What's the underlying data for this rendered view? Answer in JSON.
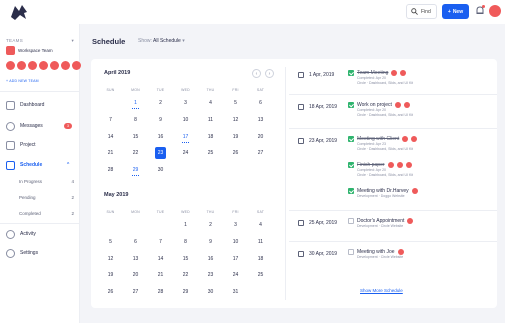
{
  "topbar": {
    "find_label": "Find",
    "new_label": "New",
    "brand_color": "#1a5ff0",
    "alert_color": "#ef5a5a"
  },
  "sidebar": {
    "teams_label": "TEAMS",
    "team_name": "Workspace Team",
    "add_team_label": "+ ADD NEW TEAM",
    "nav": [
      {
        "label": "Dashboard",
        "icon": "grid-icon"
      },
      {
        "label": "Messages",
        "icon": "chat-icon",
        "badge": "3"
      },
      {
        "label": "Project",
        "icon": "check-square-icon"
      },
      {
        "label": "Schedule",
        "icon": "calendar-icon",
        "active": true
      }
    ],
    "sub": [
      {
        "label": "In Progress",
        "count": "4"
      },
      {
        "label": "Pending",
        "count": "2"
      },
      {
        "label": "Completed",
        "count": "2"
      }
    ],
    "nav_bottom": [
      {
        "label": "Activity",
        "icon": "clock-icon"
      },
      {
        "label": "Settings",
        "icon": "gear-icon"
      }
    ]
  },
  "header": {
    "title": "Schedule",
    "show_label": "Show:",
    "show_value": "All Schedule"
  },
  "calendar": {
    "dow": [
      "SUN",
      "MON",
      "TUE",
      "WED",
      "THU",
      "FRI",
      "SAT"
    ],
    "months": [
      {
        "title": "April 2019",
        "weeks": [
          [
            "",
            "1",
            "2",
            "3",
            "4",
            "5",
            "6"
          ],
          [
            "7",
            "8",
            "9",
            "10",
            "11",
            "12",
            "13"
          ],
          [
            "14",
            "15",
            "16",
            "17",
            "18",
            "19",
            "20"
          ],
          [
            "21",
            "22",
            "23",
            "24",
            "25",
            "26",
            "27"
          ],
          [
            "28",
            "29",
            "30",
            "",
            "",
            "",
            ""
          ]
        ],
        "links": [
          "1",
          "17",
          "29"
        ],
        "today": "23"
      },
      {
        "title": "May 2019",
        "weeks": [
          [
            "",
            "",
            "",
            "1",
            "2",
            "3",
            "4"
          ],
          [
            "5",
            "6",
            "7",
            "8",
            "9",
            "10",
            "11"
          ],
          [
            "12",
            "13",
            "14",
            "15",
            "16",
            "17",
            "18"
          ],
          [
            "19",
            "20",
            "21",
            "22",
            "23",
            "24",
            "25"
          ],
          [
            "26",
            "27",
            "28",
            "29",
            "30",
            "31",
            ""
          ]
        ],
        "links": []
      }
    ]
  },
  "schedule": [
    {
      "date": "1 Apr, 2019",
      "tasks": [
        {
          "title": "Team Meeting",
          "done": true,
          "dots": 2,
          "meta": [
            "Completed: Apr 20",
            "Circle · Dashboard, Slids, and UI Kit"
          ]
        }
      ]
    },
    {
      "date": "18 Apr, 2019",
      "tasks": [
        {
          "title": "Work on project",
          "done": true,
          "strike": false,
          "dots": 2,
          "meta": [
            "Completed: Apr 20",
            "Circle · Dashboard, Slids, and UI Kit"
          ]
        }
      ]
    },
    {
      "date": "23 Apr, 2019",
      "tasks": [
        {
          "title": "Meeting with Client",
          "done": true,
          "dots": 2,
          "meta": [
            "Completed: Apr 23",
            "Circle · Dashboard, Slids, and UI Kit"
          ]
        },
        {
          "title": "Finish paper",
          "done": true,
          "dots": 3,
          "meta": [
            "Completed: Apr 20",
            "Circle · Dashboard, Slids, and UI Kit"
          ]
        },
        {
          "title": "Meeting with Dr.Harvey",
          "done": true,
          "strike": false,
          "dots": 1,
          "meta": [
            "Development · Doggo Website"
          ]
        }
      ]
    },
    {
      "date": "25 Apr, 2019",
      "tasks": [
        {
          "title": "Doctor's Appointment",
          "done": false,
          "dots": 1,
          "meta": [
            "Development · Circle Website"
          ]
        }
      ]
    },
    {
      "date": "30 Apr, 2019",
      "tasks": [
        {
          "title": "Meeting with Joe",
          "done": false,
          "dots": 1,
          "meta": [
            "Development · Circle Website"
          ]
        }
      ]
    }
  ],
  "show_more": "Show More Schedule"
}
